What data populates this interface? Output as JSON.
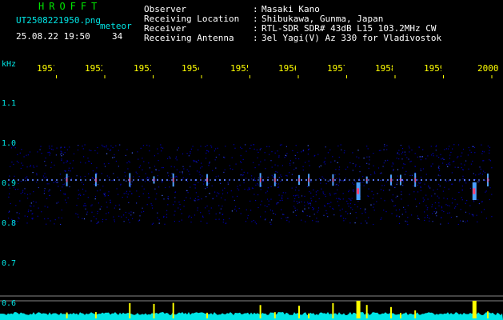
{
  "header": {
    "logo": "HROFFT",
    "filename": "UT2508221950.png",
    "kind": "meteor",
    "date": "25.08.22 19:50",
    "count": "34"
  },
  "info": [
    {
      "label": "Observer",
      "value": "Masaki Kano"
    },
    {
      "label": "Receiving Location",
      "value": "Shibukawa, Gunma, Japan"
    },
    {
      "label": "Receiver",
      "value": "RTL-SDR SDR# 43dB L15 103.2MHz CW"
    },
    {
      "label": "Receiving Antenna",
      "value": "3el Yagi(V) Az 330 for Vladivostok"
    }
  ],
  "chart_data": {
    "type": "heatmap",
    "ylabel": "kHz",
    "x_ticks": [
      "1951",
      "1952",
      "1953",
      "1954",
      "1955",
      "1956",
      "1957",
      "1958",
      "1959",
      "2000"
    ],
    "y_ticks": [
      "1.1",
      "1.0",
      "0.9",
      "0.8",
      "0.7",
      "0.6"
    ],
    "noise_band_khz": [
      0.8,
      1.0
    ],
    "carrier_khz": 0.91,
    "echoes_minute": [
      1951.2,
      1951.8,
      1952.5,
      1953.0,
      1953.4,
      1954.1,
      1955.2,
      1955.5,
      1956.0,
      1956.2,
      1956.7,
      1957.2,
      1957.4,
      1957.9,
      1958.1,
      1958.4,
      1959.6,
      1959.9
    ],
    "strong_echoes_minute": [
      1957.2,
      1959.6
    ],
    "colors": {
      "noise": "#0000aa",
      "echo": "#ff4070",
      "bottom_trace": "#00e6e6",
      "bottom_spikes": "#ffff00",
      "ticks": "#ffff00",
      "axis_labels": "#00e6e6"
    }
  }
}
